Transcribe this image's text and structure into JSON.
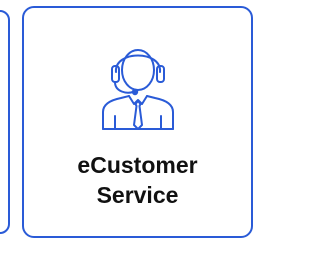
{
  "card": {
    "title_line1": "eCustomer",
    "title_line2": "Service",
    "icon": "customer-service-headset-icon"
  },
  "colors": {
    "accent": "#2a5bd7",
    "text": "#111111",
    "background": "#ffffff"
  }
}
